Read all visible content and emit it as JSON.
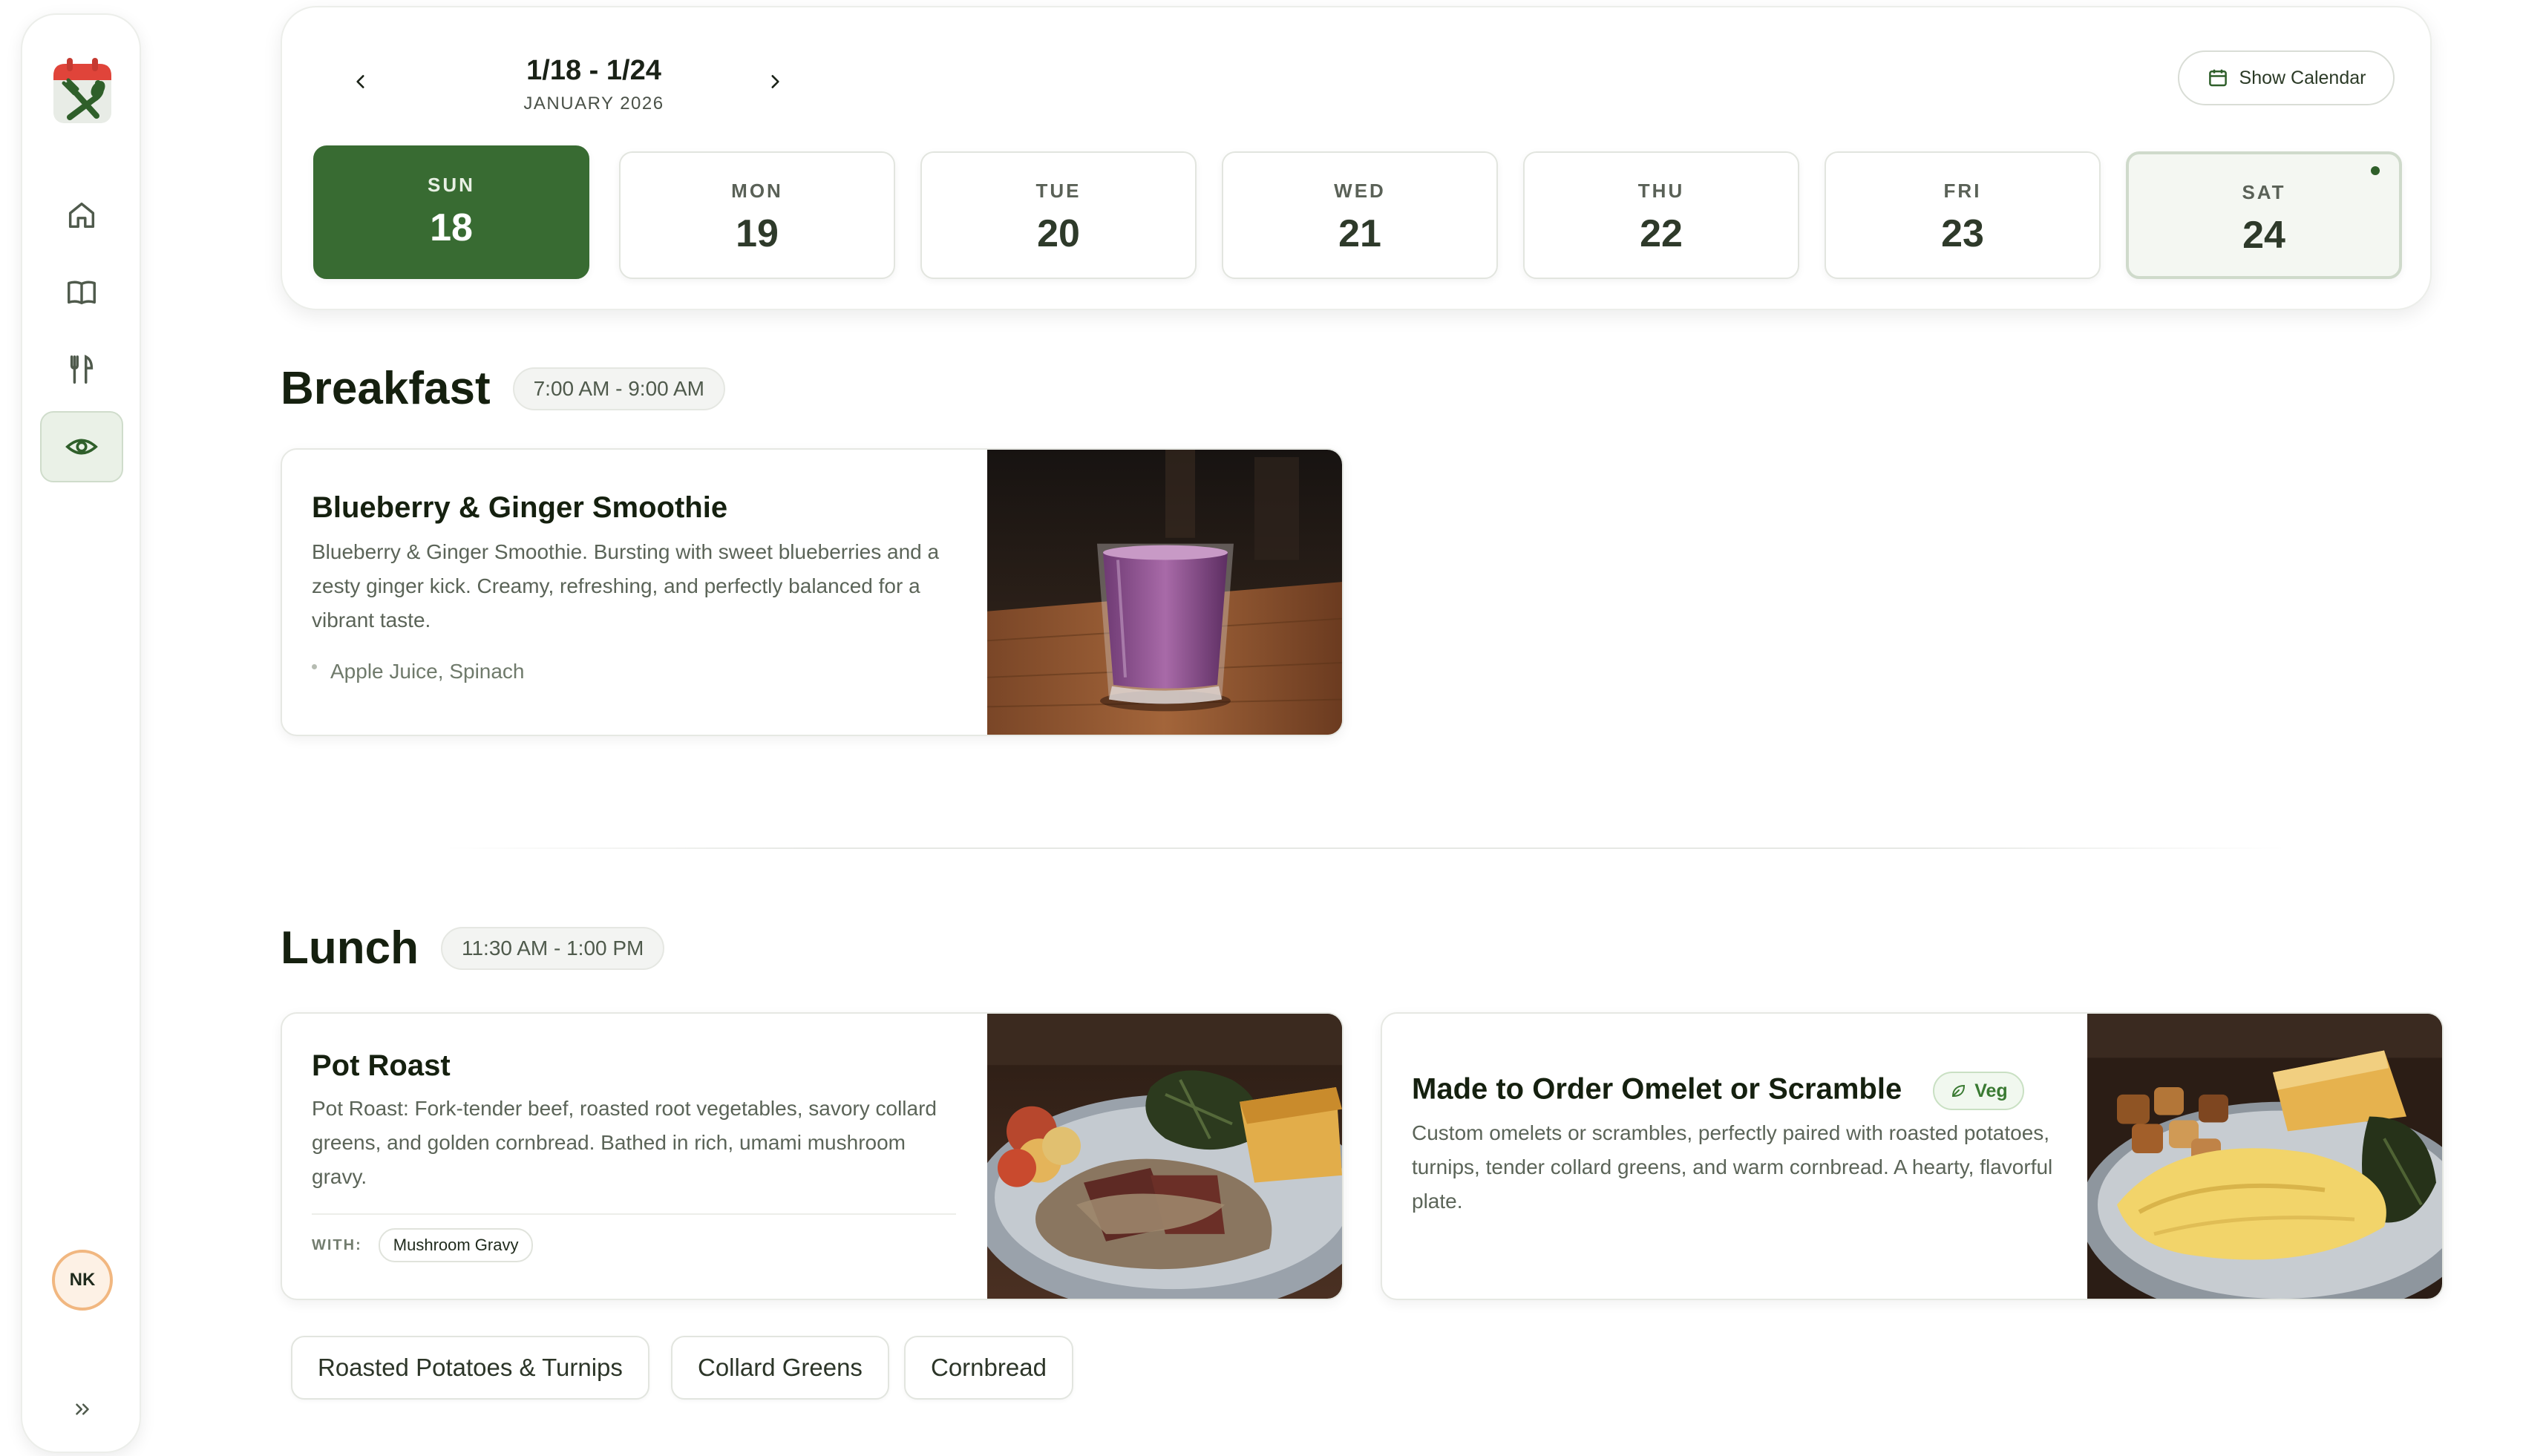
{
  "sidebar": {
    "nav": [
      {
        "icon": "home-icon"
      },
      {
        "icon": "book-icon"
      },
      {
        "icon": "utensils-icon"
      },
      {
        "icon": "eye-icon",
        "active": true
      }
    ],
    "avatar_initials": "NK",
    "expand_icon": "double-chevron-right-icon"
  },
  "week": {
    "range": "1/18 - 1/24",
    "month": "JANUARY 2026",
    "show_calendar_label": "Show Calendar",
    "days": [
      {
        "dow": "SUN",
        "num": "18"
      },
      {
        "dow": "MON",
        "num": "19"
      },
      {
        "dow": "TUE",
        "num": "20"
      },
      {
        "dow": "WED",
        "num": "21"
      },
      {
        "dow": "THU",
        "num": "22"
      },
      {
        "dow": "FRI",
        "num": "23"
      },
      {
        "dow": "SAT",
        "num": "24"
      }
    ]
  },
  "breakfast": {
    "title": "Breakfast",
    "time": "7:00 AM - 9:00 AM",
    "items": [
      {
        "name": "Blueberry & Ginger Smoothie",
        "desc": "Blueberry & Ginger Smoothie. Bursting with sweet blueberries and a zesty ginger kick. Creamy, refreshing, and perfectly balanced for a vibrant taste.",
        "ingredients": "Apple Juice, Spinach"
      }
    ]
  },
  "lunch": {
    "title": "Lunch",
    "time": "11:30 AM - 1:00 PM",
    "items": [
      {
        "name": "Pot Roast",
        "desc": "Pot Roast: Fork-tender beef, roasted root vegetables, savory collard greens, and golden cornbread. Bathed in rich, umami mushroom gravy.",
        "with_label": "WITH:",
        "with_item": "Mushroom Gravy"
      },
      {
        "name": "Made to Order Omelet or Scramble",
        "badge": "Veg",
        "desc": "Custom omelets or scrambles, perfectly paired with roasted potatoes, turnips, tender collard greens, and warm cornbread. A hearty, flavorful plate."
      }
    ],
    "sides": [
      "Roasted Potatoes & Turnips",
      "Collard Greens",
      "Cornbread"
    ]
  },
  "colors": {
    "accent": "#386b32",
    "avatar_ring": "#f1b780",
    "logo_red": "#e0443a"
  }
}
